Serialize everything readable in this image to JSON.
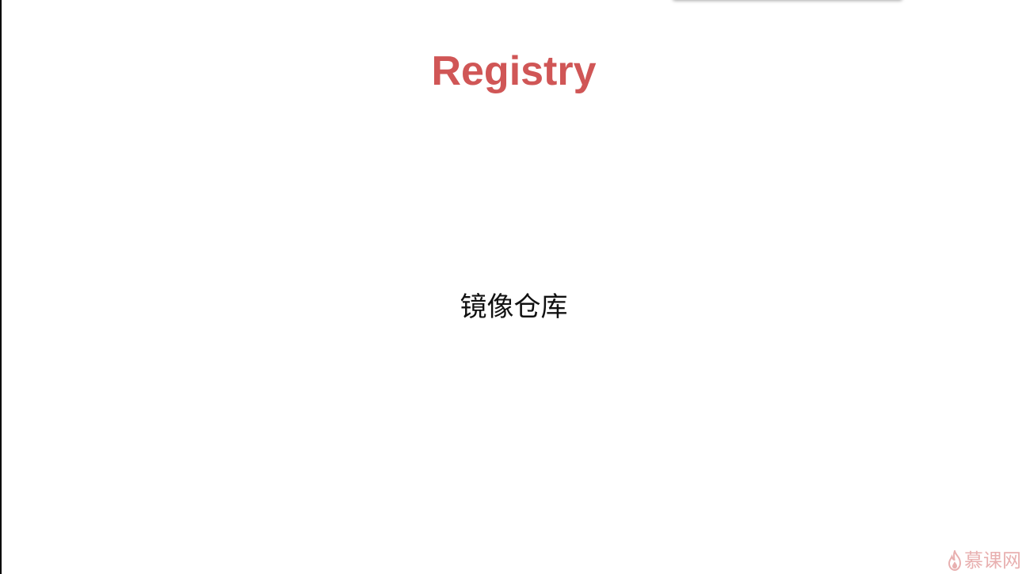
{
  "slide": {
    "title": "Registry",
    "subtitle": "镜像仓库"
  },
  "watermark": {
    "text": "慕课网",
    "icon": "flame-icon"
  },
  "colors": {
    "title": "#d05656",
    "subtitle": "#111111",
    "watermark": "#e5a3a3",
    "background": "#ffffff"
  }
}
